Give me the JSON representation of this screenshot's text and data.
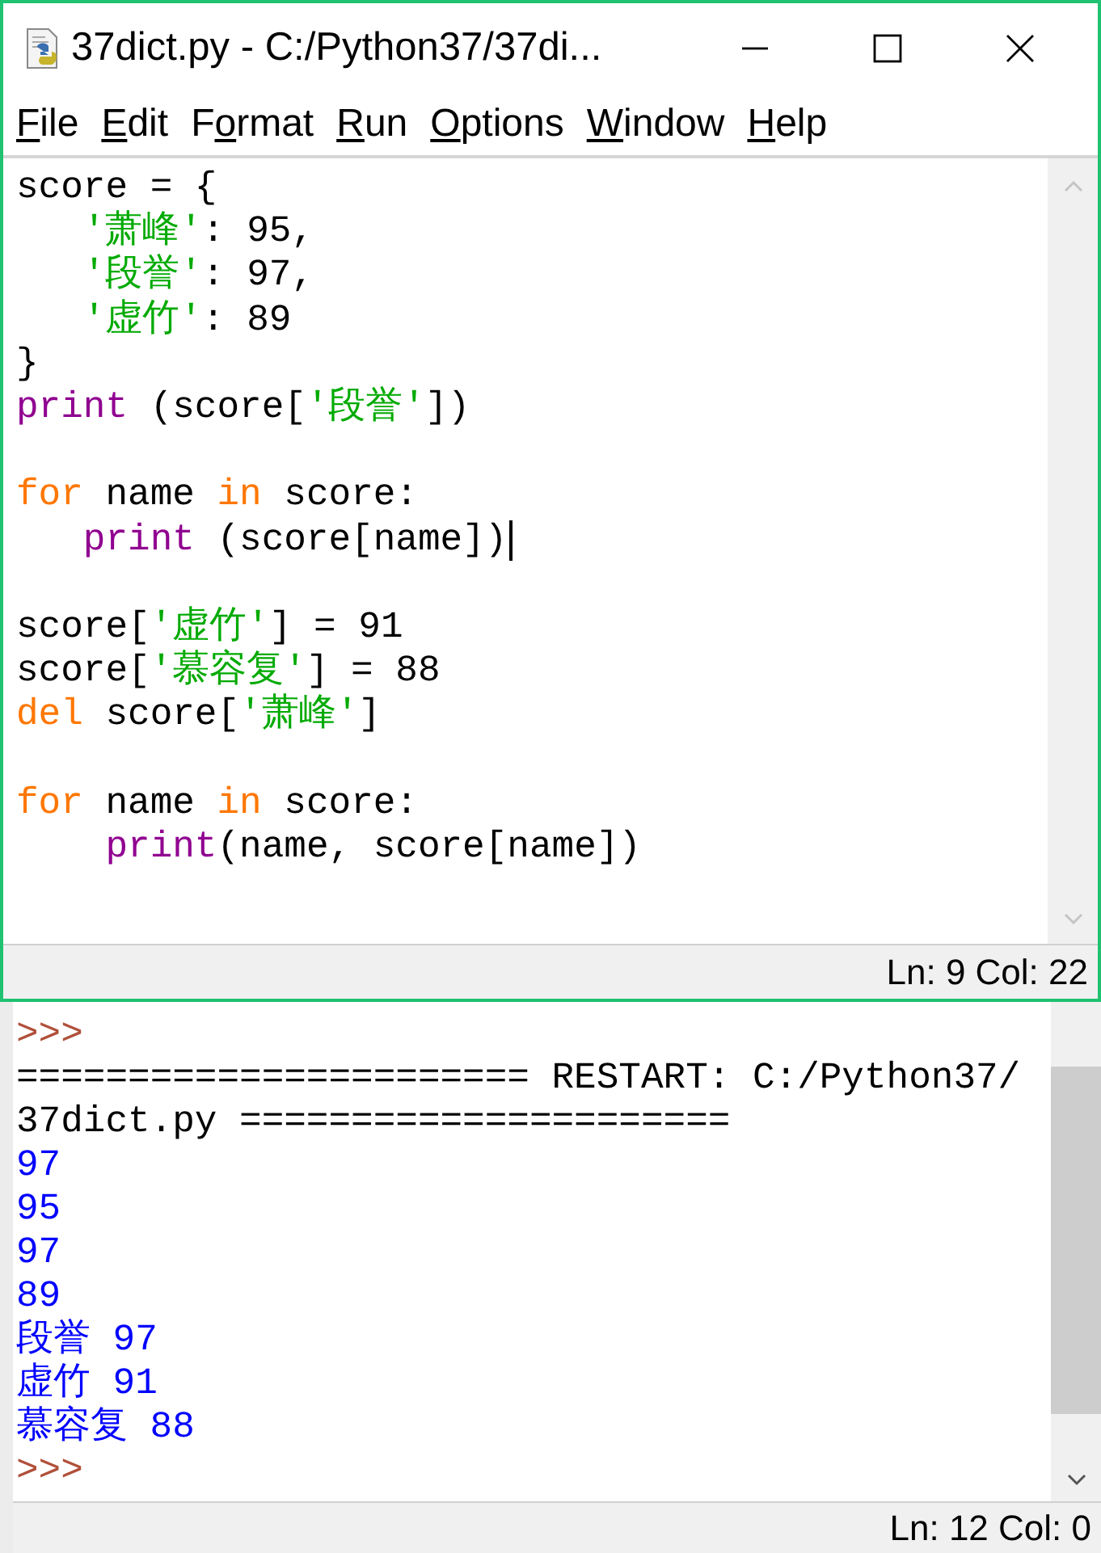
{
  "editor": {
    "window": {
      "title": "37dict.py - C:/Python37/37di..."
    },
    "menu": [
      {
        "key": "F",
        "rest": "ile"
      },
      {
        "key": "E",
        "rest": "dit"
      },
      {
        "lead": "F",
        "key": "o",
        "rest": "rmat"
      },
      {
        "key": "R",
        "rest": "un"
      },
      {
        "key": "O",
        "rest": "ptions"
      },
      {
        "key": "W",
        "rest": "indow"
      },
      {
        "key": "H",
        "rest": "elp"
      }
    ],
    "lines": [
      {
        "kind": "code",
        "tokens": [
          {
            "text": "score = {",
            "kind": "plain"
          }
        ]
      },
      {
        "kind": "code",
        "tokens": [
          {
            "text": "   '萧峰'",
            "kind": "string"
          },
          {
            "text": ": 95,",
            "kind": "plain"
          }
        ]
      },
      {
        "kind": "code",
        "tokens": [
          {
            "text": "   '段誉'",
            "kind": "string"
          },
          {
            "text": ": 97,",
            "kind": "plain"
          }
        ]
      },
      {
        "kind": "code",
        "tokens": [
          {
            "text": "   '虚竹'",
            "kind": "string"
          },
          {
            "text": ": 89",
            "kind": "plain"
          }
        ]
      },
      {
        "kind": "code",
        "tokens": [
          {
            "text": "}",
            "kind": "plain"
          }
        ]
      },
      {
        "kind": "code",
        "tokens": [
          {
            "text": "print",
            "kind": "builtin"
          },
          {
            "text": " (score[",
            "kind": "plain"
          },
          {
            "text": "'段誉'",
            "kind": "string"
          },
          {
            "text": "])",
            "kind": "plain"
          }
        ]
      },
      {
        "kind": "blank"
      },
      {
        "kind": "code",
        "tokens": [
          {
            "text": "for",
            "kind": "keyword"
          },
          {
            "text": " name ",
            "kind": "plain"
          },
          {
            "text": "in",
            "kind": "keyword"
          },
          {
            "text": " score:",
            "kind": "plain"
          }
        ]
      },
      {
        "kind": "code",
        "tokens": [
          {
            "text": "   print",
            "kind": "builtin"
          },
          {
            "text": " (score[name])",
            "kind": "plain"
          },
          {
            "kind": "caret"
          }
        ]
      },
      {
        "kind": "blank"
      },
      {
        "kind": "code",
        "tokens": [
          {
            "text": "score[",
            "kind": "plain"
          },
          {
            "text": "'虚竹'",
            "kind": "string"
          },
          {
            "text": "] = 91",
            "kind": "plain"
          }
        ]
      },
      {
        "kind": "code",
        "tokens": [
          {
            "text": "score[",
            "kind": "plain"
          },
          {
            "text": "'慕容复'",
            "kind": "string"
          },
          {
            "text": "] = 88",
            "kind": "plain"
          }
        ]
      },
      {
        "kind": "code",
        "tokens": [
          {
            "text": "del",
            "kind": "keyword"
          },
          {
            "text": " score[",
            "kind": "plain"
          },
          {
            "text": "'萧峰'",
            "kind": "string"
          },
          {
            "text": "]",
            "kind": "plain"
          }
        ]
      },
      {
        "kind": "blank"
      },
      {
        "kind": "code",
        "tokens": [
          {
            "text": "for",
            "kind": "keyword"
          },
          {
            "text": " name ",
            "kind": "plain"
          },
          {
            "text": "in",
            "kind": "keyword"
          },
          {
            "text": " score:",
            "kind": "plain"
          }
        ]
      },
      {
        "kind": "code",
        "tokens": [
          {
            "text": "    print",
            "kind": "builtin"
          },
          {
            "text": "(name, score[name])",
            "kind": "plain"
          }
        ]
      }
    ],
    "status_bar": "Ln: 9 Col: 22"
  },
  "shell": {
    "lines": [
      {
        "text": ">>>",
        "kind": "prompt"
      },
      {
        "text": "======================= RESTART: C:/Python37/",
        "kind": "plain"
      },
      {
        "text": "37dict.py ======================",
        "kind": "plain"
      },
      {
        "text": "97",
        "kind": "output"
      },
      {
        "text": "95",
        "kind": "output"
      },
      {
        "text": "97",
        "kind": "output"
      },
      {
        "text": "89",
        "kind": "output"
      },
      {
        "text": "段誉 97",
        "kind": "output"
      },
      {
        "text": "虚竹 91",
        "kind": "output"
      },
      {
        "text": "慕容复 88",
        "kind": "output"
      },
      {
        "text": ">>>",
        "kind": "prompt"
      }
    ],
    "status_bar": "Ln: 12 Col: 0"
  }
}
